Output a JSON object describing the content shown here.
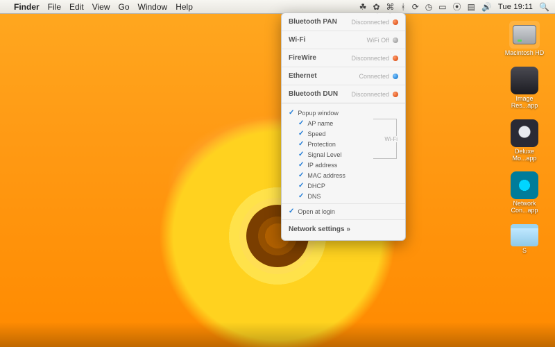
{
  "menubar": {
    "app_name": "Finder",
    "menus": [
      "File",
      "Edit",
      "View",
      "Go",
      "Window",
      "Help"
    ],
    "clock": "Tue 19:11",
    "status_icons": [
      "leaf",
      "puzzle",
      "flower",
      "yinyang",
      "bluetooth",
      "sync",
      "timemachine",
      "battery",
      "wifi",
      "flag",
      "volume"
    ]
  },
  "panel": {
    "interfaces": [
      {
        "name": "Bluetooth PAN",
        "status": "Disconnected",
        "dot": "red"
      },
      {
        "name": "Wi-Fi",
        "status": "WiFi Off",
        "dot": "grey"
      },
      {
        "name": "FireWire",
        "status": "Disconnected",
        "dot": "red"
      },
      {
        "name": "Ethernet",
        "status": "Connected",
        "dot": "blue"
      },
      {
        "name": "Bluetooth DUN",
        "status": "Disconnected",
        "dot": "red"
      }
    ],
    "options_header": "Popup window",
    "wifi_group_label": "Wi-Fi",
    "wifi_options": [
      "AP name",
      "Speed",
      "Protection",
      "Signal Level"
    ],
    "other_options": [
      "IP address",
      "MAC address",
      "DHCP",
      "DNS"
    ],
    "open_at_login": "Open at login",
    "network_settings": "Network settings"
  },
  "desktop_icons": [
    {
      "label": "Macintosh HD",
      "kind": "hd"
    },
    {
      "label": "Image Res...app",
      "kind": "app1"
    },
    {
      "label": "Deluxe Mo...app",
      "kind": "app2"
    },
    {
      "label": "Network Con...app",
      "kind": "app3"
    },
    {
      "label": "S",
      "kind": "folder"
    }
  ]
}
